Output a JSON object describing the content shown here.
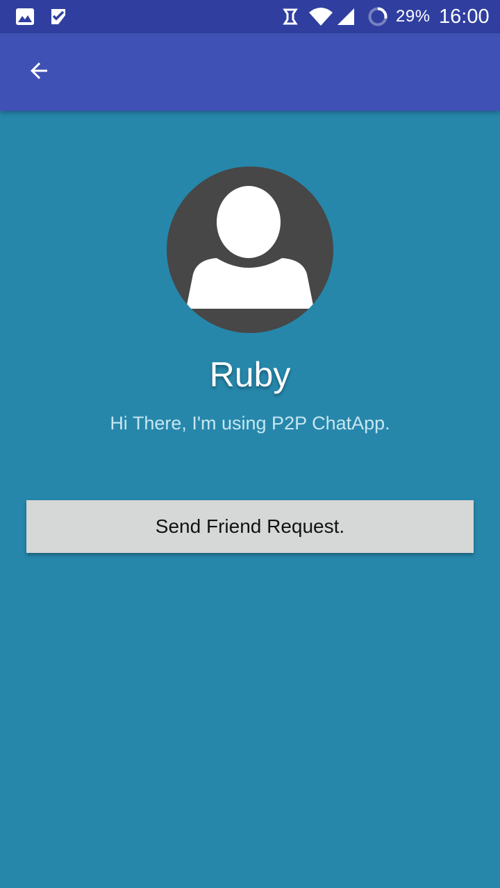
{
  "status_bar": {
    "icons": [
      "gallery-icon",
      "task-check-icon",
      "data-saver-icon",
      "wifi-icon",
      "cell-signal-icon",
      "battery-ring-icon"
    ],
    "battery_percent": "29%",
    "time": "16:00",
    "background_color": "#303f9f"
  },
  "app_bar": {
    "back_icon": "arrow-back-icon",
    "background_color": "#3f51b5"
  },
  "profile": {
    "avatar_icon": "default-user-avatar-icon",
    "name": "Ruby",
    "status": "Hi There, I'm using P2P ChatApp."
  },
  "actions": {
    "send_request_label": "Send Friend Request."
  },
  "colors": {
    "page_background": "#2687ab",
    "button_background": "#d6d7d7",
    "avatar_background": "#474747"
  }
}
